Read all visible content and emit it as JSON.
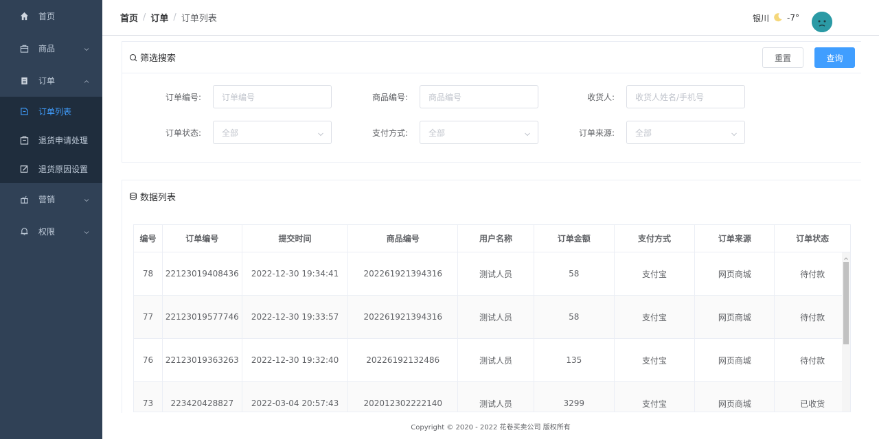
{
  "sidebar": {
    "items": [
      {
        "label": "首页",
        "icon": "home-icon"
      },
      {
        "label": "商品",
        "icon": "bag-icon"
      },
      {
        "label": "订单",
        "icon": "clipboard-icon"
      }
    ],
    "order_sub": [
      {
        "label": "订单列表",
        "icon": "list-icon"
      },
      {
        "label": "退货申请处理",
        "icon": "return-icon"
      },
      {
        "label": "退货原因设置",
        "icon": "edit-icon"
      }
    ],
    "items_after": [
      {
        "label": "营销",
        "icon": "gift-icon"
      },
      {
        "label": "权限",
        "icon": "bell-icon"
      }
    ]
  },
  "breadcrumb": {
    "home": "首页",
    "sep": "/",
    "order": "订单",
    "current": "订单列表"
  },
  "header": {
    "city": "银川",
    "temp": "-7°"
  },
  "filter": {
    "title": "筛选搜索",
    "reset_label": "重置",
    "query_label": "查询",
    "fields": [
      {
        "label": "订单编号:",
        "placeholder": "订单编号"
      },
      {
        "label": "商品编号:",
        "placeholder": "商品编号"
      },
      {
        "label": "收货人:",
        "placeholder": "收货人姓名/手机号"
      },
      {
        "label": "订单状态:",
        "value": "全部"
      },
      {
        "label": "支付方式:",
        "value": "全部"
      },
      {
        "label": "订单来源:",
        "value": "全部"
      }
    ]
  },
  "table": {
    "title": "数据列表",
    "headers": [
      "编号",
      "订单编号",
      "提交时间",
      "商品编号",
      "用户名称",
      "订单金额",
      "支付方式",
      "订单来源",
      "订单状态"
    ],
    "rows": [
      [
        "78",
        "22123019408436",
        "2022-12-30 19:34:41",
        "202261921394316",
        "测试人员",
        "58",
        "支付宝",
        "网页商城",
        "待付款"
      ],
      [
        "77",
        "22123019577746",
        "2022-12-30 19:33:57",
        "202261921394316",
        "测试人员",
        "58",
        "支付宝",
        "网页商城",
        "待付款"
      ],
      [
        "76",
        "22123019363263",
        "2022-12-30 19:32:40",
        "20226192132486",
        "测试人员",
        "135",
        "支付宝",
        "网页商城",
        "待付款"
      ],
      [
        "73",
        "223420428827",
        "2022-03-04 20:57:43",
        "202012302222140",
        "测试人员",
        "3299",
        "支付宝",
        "网页商城",
        "已收货"
      ]
    ]
  },
  "footer": {
    "text": "Copyright © 2020 - 2022 花卷买卖公司 版权所有"
  },
  "colors": {
    "sidebar": "#304156",
    "submenu": "#1f2d3d",
    "accent": "#409eff"
  }
}
